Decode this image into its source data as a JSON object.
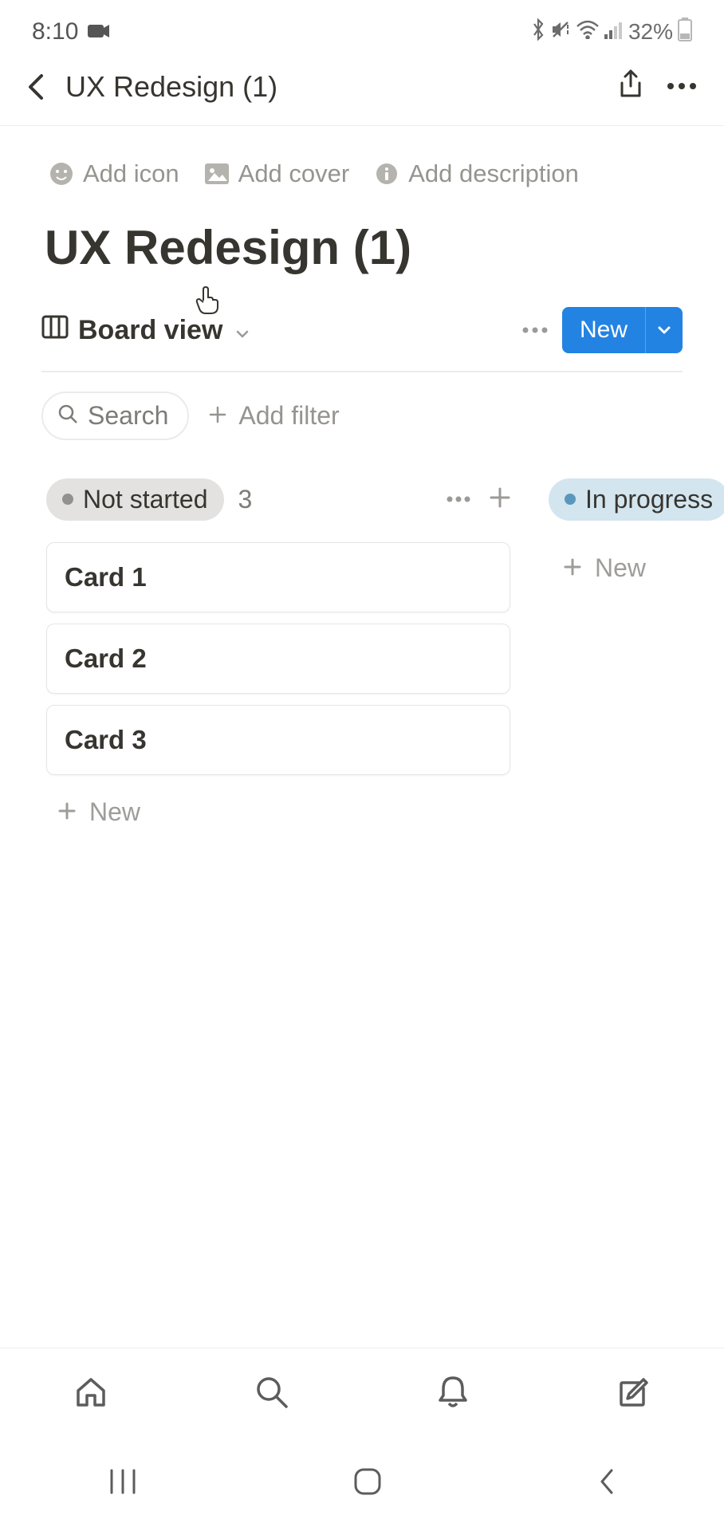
{
  "status_bar": {
    "time": "8:10",
    "battery_pct": "32%"
  },
  "top_nav": {
    "title": "UX Redesign (1)"
  },
  "meta": {
    "add_icon": "Add icon",
    "add_cover": "Add cover",
    "add_description": "Add description"
  },
  "page": {
    "title": "UX Redesign (1)"
  },
  "view": {
    "name": "Board view",
    "new_label": "New"
  },
  "filter": {
    "search_label": "Search",
    "add_filter_label": "Add filter"
  },
  "board": {
    "columns": [
      {
        "status": "Not started",
        "count": "3",
        "color": "gray",
        "cards": [
          "Card 1",
          "Card 2",
          "Card 3"
        ],
        "new_label": "New"
      },
      {
        "status": "In progress",
        "count": "",
        "color": "blue",
        "cards": [],
        "new_label": "New"
      }
    ]
  }
}
